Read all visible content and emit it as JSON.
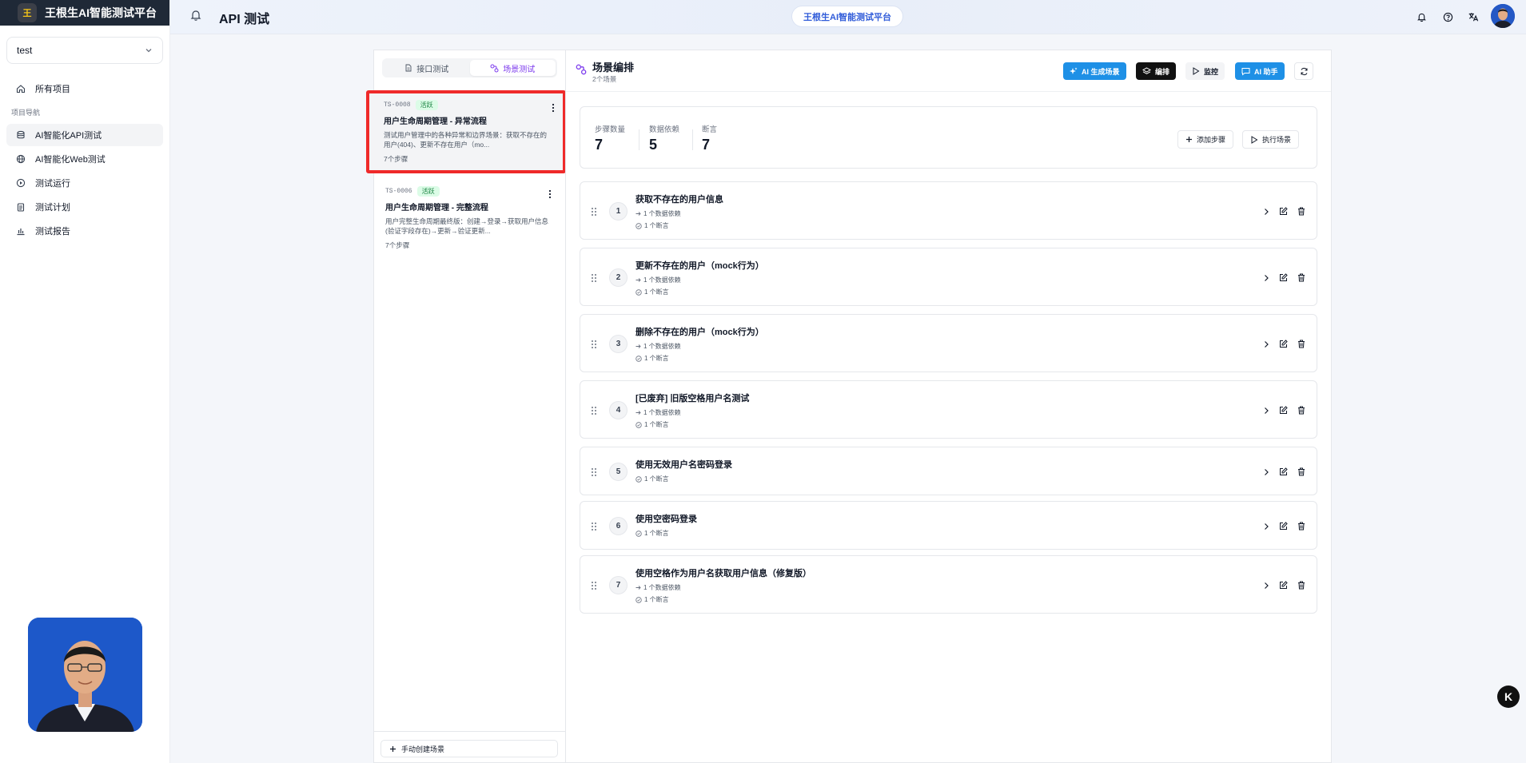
{
  "app": {
    "brand": "王根生AI智能测试平台",
    "logo_glyph": "王"
  },
  "sidebar": {
    "project": "test",
    "all_projects": "所有项目",
    "section_label": "项目导航",
    "items": [
      {
        "label": "AI智能化API测试",
        "icon": "database-icon",
        "active": true
      },
      {
        "label": "AI智能化Web测试",
        "icon": "globe-icon",
        "active": false
      },
      {
        "label": "测试运行",
        "icon": "play-circle-icon",
        "active": false
      },
      {
        "label": "测试计划",
        "icon": "clipboard-icon",
        "active": false
      },
      {
        "label": "测试报告",
        "icon": "bar-chart-icon",
        "active": false
      }
    ]
  },
  "header": {
    "title": "API 测试",
    "platform_pill": "王根生AI智能测试平台"
  },
  "left_panel": {
    "tabs": [
      {
        "label": "接口测试",
        "active": false
      },
      {
        "label": "场景测试",
        "active": true
      }
    ],
    "scenarios": [
      {
        "id": "TS-0008",
        "status": "活跃",
        "title": "用户生命周期管理 - 异常流程",
        "desc": "测试用户管理中的各种异常和边界场景：获取不存在的用户(404)、更新不存在用户（mo...",
        "steps": "7个步骤",
        "selected": true
      },
      {
        "id": "TS-0006",
        "status": "活跃",
        "title": "用户生命周期管理 - 完整流程",
        "desc": "用户完整生命周期最终版：创建→登录→获取用户信息(验证字段存在)→更新→验证更新...",
        "steps": "7个步骤",
        "selected": false
      }
    ],
    "create_button": "手动创建场景"
  },
  "right_panel": {
    "title": "场景编排",
    "subtitle": "2个场景",
    "buttons": {
      "ai_generate": "AI 生成场景",
      "edit": "编排",
      "monitor": "监控",
      "ai_helper": "AI 助手"
    },
    "stats": [
      {
        "label": "步骤数量",
        "value": "7"
      },
      {
        "label": "数据依赖",
        "value": "5"
      },
      {
        "label": "断言",
        "value": "7"
      }
    ],
    "add_step": "添加步骤",
    "run_scenario": "执行场景",
    "steps": [
      {
        "num": "1",
        "name": "获取不存在的用户信息",
        "dep": "1 个数据依赖",
        "assert": "1 个断言"
      },
      {
        "num": "2",
        "name": "更新不存在的用户（mock行为）",
        "dep": "1 个数据依赖",
        "assert": "1 个断言"
      },
      {
        "num": "3",
        "name": "删除不存在的用户（mock行为）",
        "dep": "1 个数据依赖",
        "assert": "1 个断言"
      },
      {
        "num": "4",
        "name": "[已废弃] 旧版空格用户名测试",
        "dep": "1 个数据依赖",
        "assert": "1 个断言"
      },
      {
        "num": "5",
        "name": "使用无效用户名密码登录",
        "dep": "",
        "assert": "1 个断言"
      },
      {
        "num": "6",
        "name": "使用空密码登录",
        "dep": "",
        "assert": "1 个断言"
      },
      {
        "num": "7",
        "name": "使用空格作为用户名获取用户信息（修复版）",
        "dep": "1 个数据依赖",
        "assert": "1 个断言"
      }
    ]
  },
  "floating": {
    "label": "K"
  },
  "colors": {
    "accent_blue": "#1e90e6",
    "accent_purple": "#7c3aed",
    "selection_red": "#ef2a2a",
    "active_green": "#15803d"
  }
}
